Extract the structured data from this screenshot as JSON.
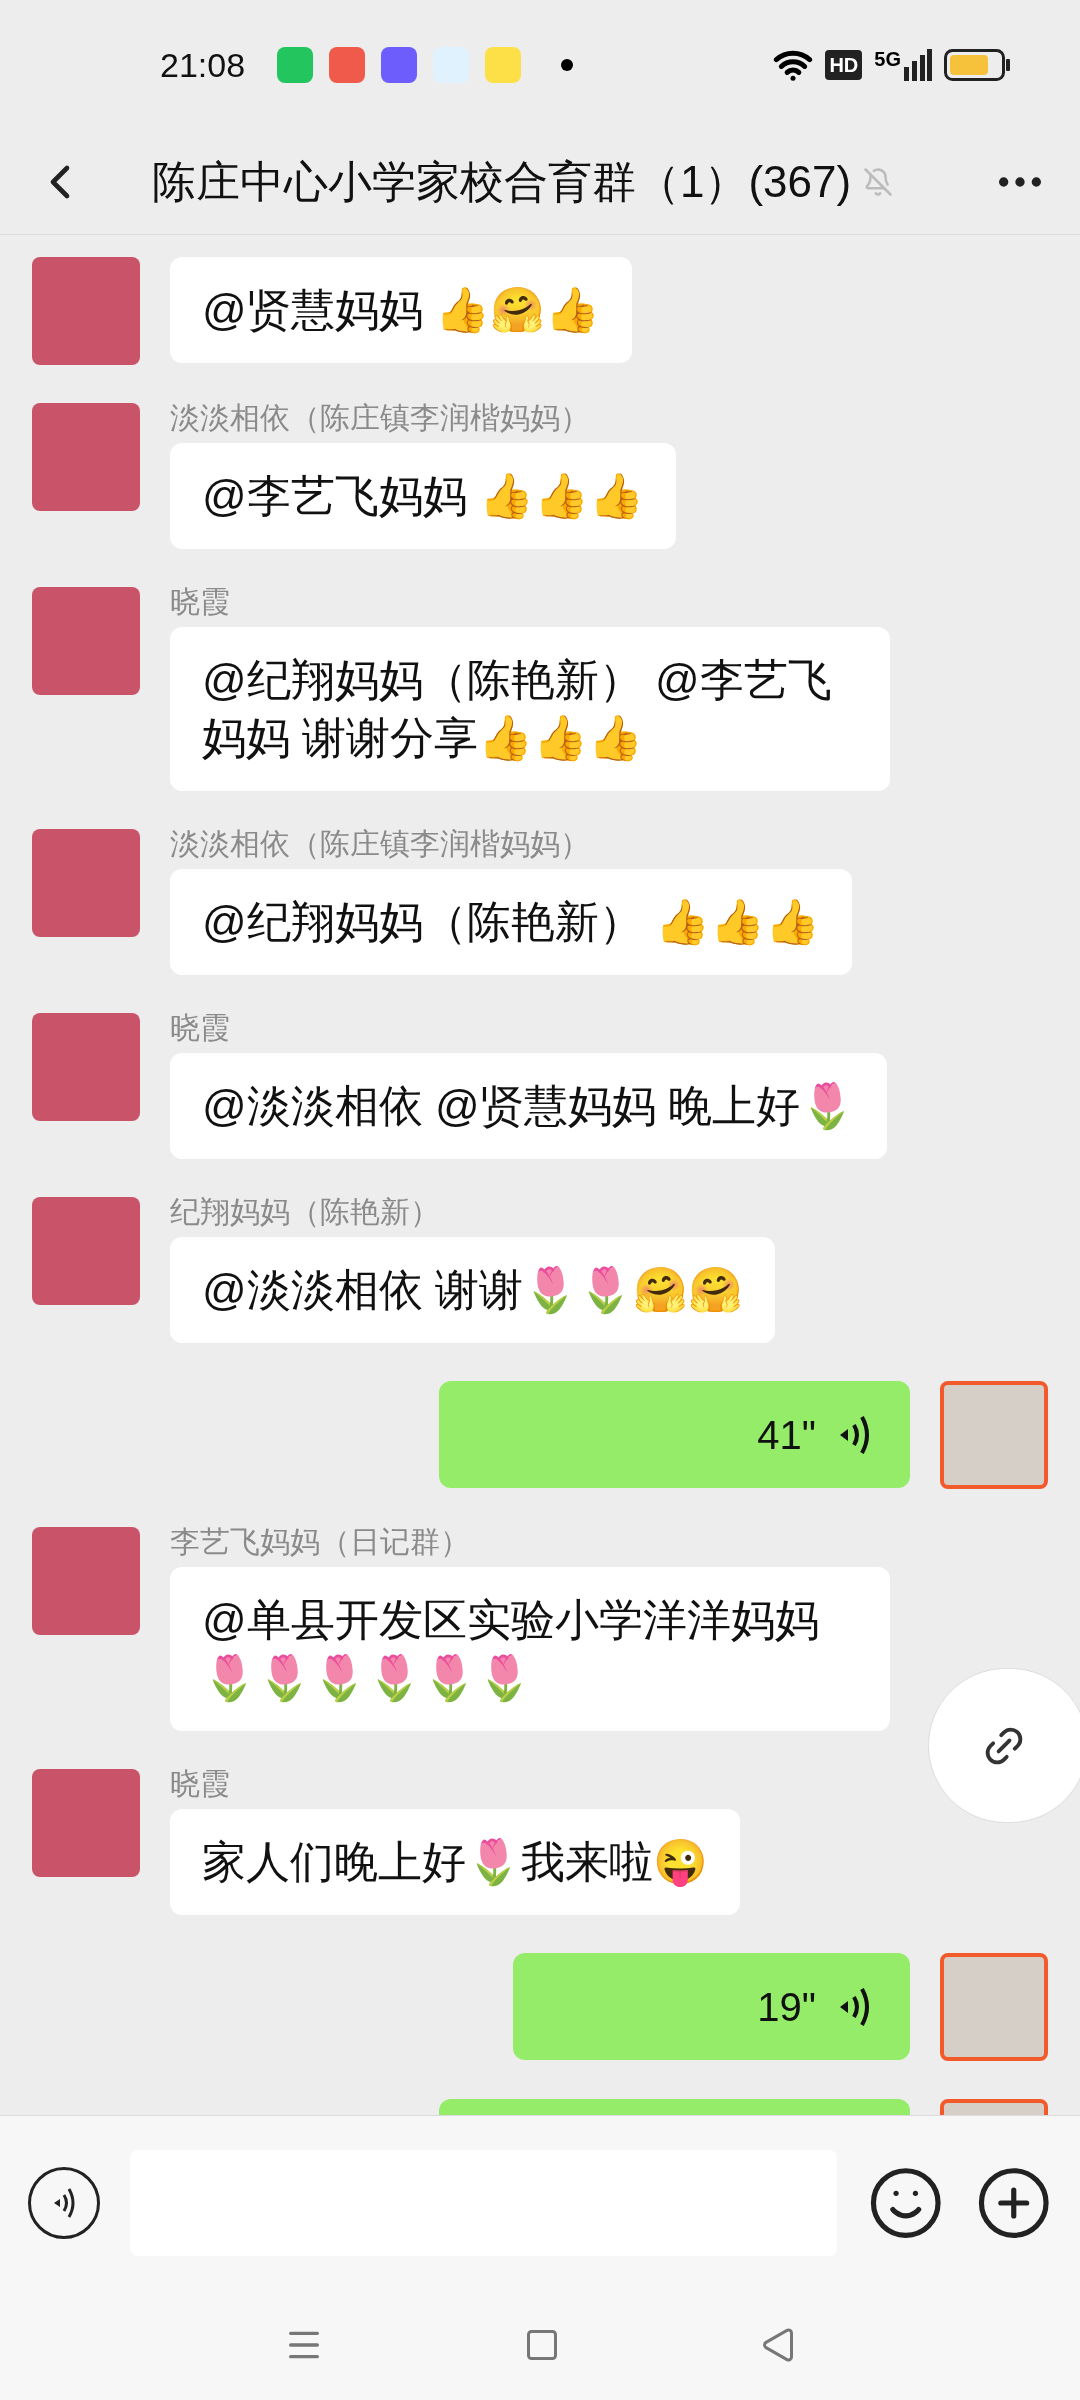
{
  "status_bar": {
    "time": "21:08",
    "hd": "HD",
    "network": "5G"
  },
  "header": {
    "title": "陈庄中心小学家校合育群（1）(367)"
  },
  "messages": [
    {
      "kind": "text",
      "outgoing": false,
      "text": "@贤慧妈妈 👍🤗👍"
    },
    {
      "kind": "text",
      "outgoing": false,
      "sender": "淡淡相依（陈庄镇李润楷妈妈）",
      "text": "@李艺飞妈妈 👍👍👍"
    },
    {
      "kind": "text",
      "outgoing": false,
      "sender": "晓霞",
      "text": "@纪翔妈妈（陈艳新） @李艺飞妈妈  谢谢分享👍👍👍"
    },
    {
      "kind": "text",
      "outgoing": false,
      "sender": "淡淡相依（陈庄镇李润楷妈妈）",
      "text": "@纪翔妈妈（陈艳新） 👍👍👍"
    },
    {
      "kind": "text",
      "outgoing": false,
      "sender": "晓霞",
      "text": "@淡淡相依 @贤慧妈妈  晚上好🌷"
    },
    {
      "kind": "text",
      "outgoing": false,
      "sender": "纪翔妈妈（陈艳新）",
      "text": "@淡淡相依  谢谢🌷🌷🤗🤗"
    },
    {
      "kind": "voice",
      "outgoing": true,
      "duration": "41\""
    },
    {
      "kind": "text",
      "outgoing": false,
      "sender": "李艺飞妈妈（日记群）",
      "text": "@单县开发区实验小学洋洋妈妈🌷🌷🌷🌷🌷🌷"
    },
    {
      "kind": "text",
      "outgoing": false,
      "sender": "晓霞",
      "text": "家人们晚上好🌷我来啦😜"
    },
    {
      "kind": "voice",
      "outgoing": true,
      "duration": "19\""
    },
    {
      "kind": "voice",
      "outgoing": true
    }
  ]
}
